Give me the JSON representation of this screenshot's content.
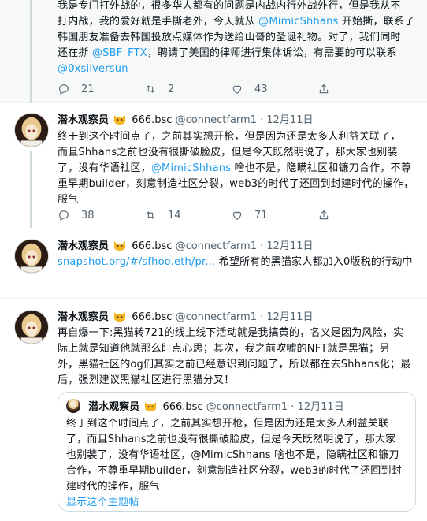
{
  "tweet1": {
    "lines": [
      "我是专门打外战的，很多华人都有的问题是内战内行外战外行，但是我从不",
      "打内战，我的爱好就是手撕老外，今天就从 ",
      "@MimicShhans",
      " 开始撕，联系了",
      "韩国朋友准备去韩国投放点媒体作为送给山哥的圣诞礼物。对了，我们同时",
      "还在撕 ",
      "@SBF_FTX",
      "，聘请了美国的律师进行集体诉讼，有需要的可以联系",
      "@0xsilversun"
    ],
    "replies": "21",
    "retweets": "2",
    "likes": "43"
  },
  "author": {
    "name": "潜水观察员",
    "badge": "666.bsc",
    "handle": "@connectfarm1",
    "dot": "·",
    "date": "12月11日"
  },
  "tweet2": {
    "lines": [
      "终于到这个时间点了，之前其实想开枪，但是因为还是太多人利益关联了，",
      "而且Shhans之前也没有很撕破脸皮，但是今天既然明说了，那大家也别装",
      "了，没有华语社区，",
      "@MimicShhans",
      " 啥也不是，隐瞒社区和镰刀合作，不尊",
      "重早期builder，刻意制造社区分裂，web3的时代了还回到封建时代的操作，",
      "服气"
    ],
    "replies": "38",
    "retweets": "14",
    "likes": "71"
  },
  "tweet3": {
    "link": "snapshot.org/#/sfhoo.eth/pr...",
    "text": " 希望所有的黑猫家人都加入0版税的行动中"
  },
  "tweet4": {
    "lines": [
      "再自爆一下:黑猫转721的线上线下活动就是我搞黄的，名义是因为风险，实",
      "际上就是知道他就那么盯点心思；其次，我之前吹嘘的NFT就是黑猫；另",
      "外，黑猫社区的og们其实之前已经意识到问题了，所以都在去Shhans化；最",
      "后，强烈建议黑猫社区进行黑猫分叉！"
    ]
  },
  "quote": {
    "lines": [
      "终于到这个时间点了，之前其实想开枪，但是因为还是太多人利益关联",
      "了，而且Shhans之前也没有很撕破脸皮，但是今天既然明说了，那大家",
      "也别装了，没有华语社区，",
      "@MimicShhans",
      " 啥也不是，隐瞒社区和镰刀",
      "合作，不尊重早期builder，刻意制造社区分裂，web3的时代了还回到封",
      "建时代的操作，服气"
    ],
    "show_thread": "显示这个主题帖"
  }
}
